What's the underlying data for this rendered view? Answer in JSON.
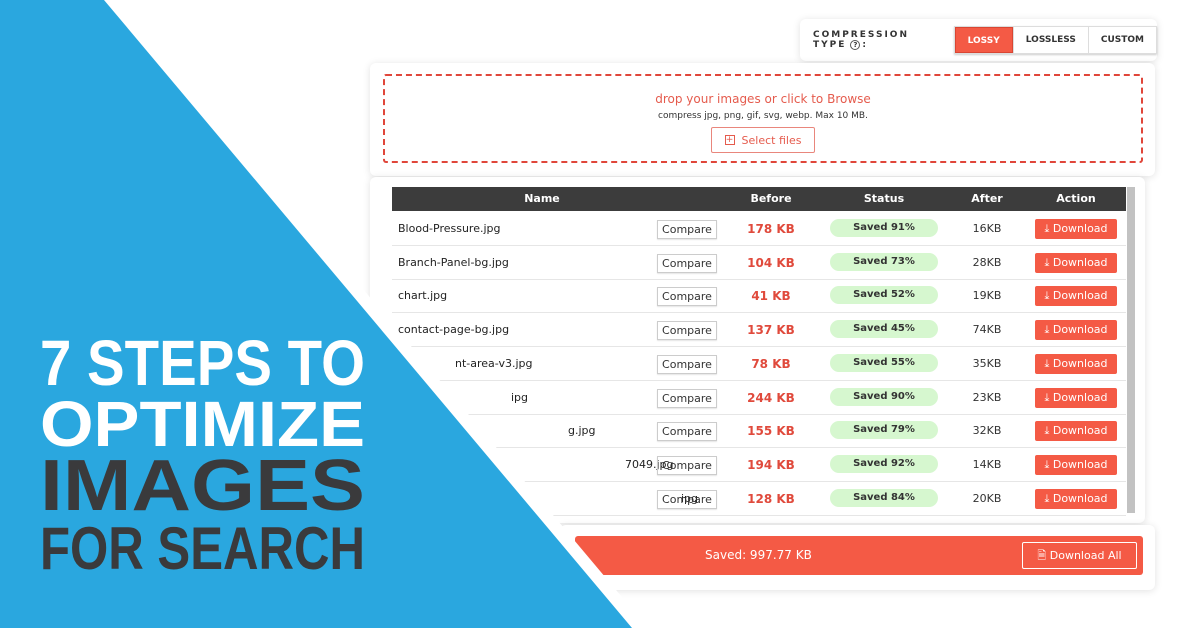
{
  "compression": {
    "label": "COMPRESSION TYPE",
    "help_icon": "?",
    "colon": ":",
    "options": [
      "LOSSY",
      "LOSSLESS",
      "CUSTOM"
    ],
    "selected": "LOSSY"
  },
  "upload": {
    "title": "drop your images or click to Browse",
    "subtitle": "compress jpg, png, gif, svg, webp. Max 10 MB.",
    "button": "Select files"
  },
  "table": {
    "headers": [
      "Name",
      "Before",
      "Status",
      "After",
      "Action"
    ],
    "rows": [
      {
        "name": "Blood-Pressure.jpg",
        "compare": "Compare",
        "before": "178 KB",
        "status": "Saved 91%",
        "after": "16KB",
        "action": "Download"
      },
      {
        "name": "Branch-Panel-bg.jpg",
        "compare": "Compare",
        "before": "104 KB",
        "status": "Saved 73%",
        "after": "28KB",
        "action": "Download"
      },
      {
        "name": "chart.jpg",
        "compare": "Compare",
        "before": "41 KB",
        "status": "Saved 52%",
        "after": "19KB",
        "action": "Download"
      },
      {
        "name": "contact-page-bg.jpg",
        "compare": "Compare",
        "before": "137 KB",
        "status": "Saved 45%",
        "after": "74KB",
        "action": "Download"
      },
      {
        "name": "nt-area-v3.jpg",
        "compare": "Compare",
        "before": "78 KB",
        "status": "Saved 55%",
        "after": "35KB",
        "action": "Download"
      },
      {
        "name": "ipg",
        "compare": "Compare",
        "before": "244 KB",
        "status": "Saved 90%",
        "after": "23KB",
        "action": "Download"
      },
      {
        "name": "g.jpg",
        "compare": "Compare",
        "before": "155 KB",
        "status": "Saved 79%",
        "after": "32KB",
        "action": "Download"
      },
      {
        "name": "7049.jpg",
        "compare": "Compare",
        "before": "194 KB",
        "status": "Saved 92%",
        "after": "14KB",
        "action": "Download"
      },
      {
        "name": "ipg",
        "compare": "Compare",
        "before": "128 KB",
        "status": "Saved 84%",
        "after": "20KB",
        "action": "Download"
      }
    ]
  },
  "footer": {
    "saved": "Saved: 997.77 KB",
    "download_all": "Download All"
  },
  "headline": {
    "line1": "7 STEPS TO",
    "line2": "OPTIMIZE",
    "line3": "IMAGES",
    "line4": "FOR SEARCH"
  },
  "colors": {
    "accent": "#f45a45",
    "blue": "#2aa7df",
    "dark_text": "#3a3a3c",
    "status_bg": "#d6f7cf"
  }
}
